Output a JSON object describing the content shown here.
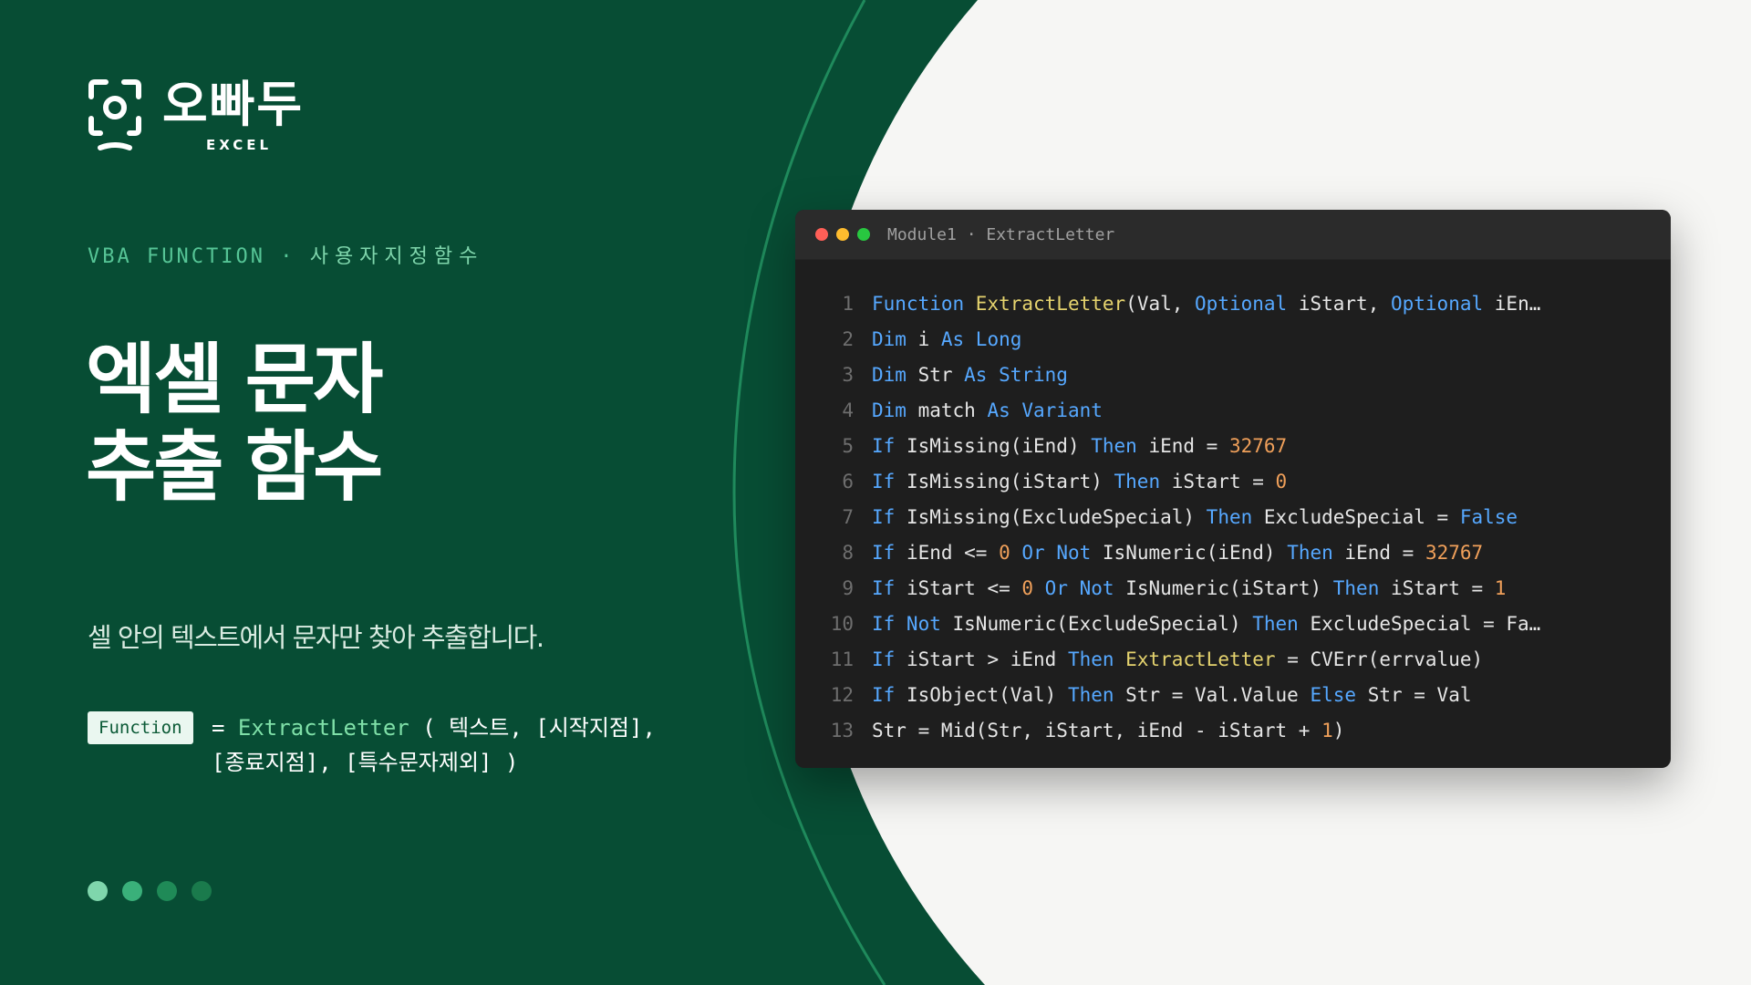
{
  "colors": {
    "dark_green": "#074d34",
    "accent_green": "#56c596",
    "light_bg": "#f6f6f4",
    "editor_bg": "#1e1e1e"
  },
  "brand": {
    "name": "오빠두",
    "sub": "EXCEL",
    "icon": "camera-face-icon"
  },
  "subtitle": {
    "en": "VBA FUNCTION",
    "sep": "·",
    "ko": "사용자지정함수"
  },
  "title": {
    "line1": "엑셀 문자",
    "line2": "추출 함수"
  },
  "description": "셀 안의 텍스트에서 문자만 찾아 추출합니다.",
  "syntax": {
    "badge": "Function",
    "equals": "=",
    "fn": "ExtractLetter",
    "args_line1": "( 텍스트, [시작지점],",
    "args_line2": "[종료지점], [특수문자제외] )"
  },
  "pagination": {
    "total": 4
  },
  "editor": {
    "title": "Module1 · ExtractLetter",
    "lines": [
      {
        "n": "1",
        "t": [
          [
            "kw",
            "Function "
          ],
          [
            "fnn",
            "ExtractLetter"
          ],
          [
            "",
            "(Val, "
          ],
          [
            "kw",
            "Optional"
          ],
          [
            "",
            " iStart, "
          ],
          [
            "kw",
            "Optional"
          ],
          [
            "",
            " iEn…"
          ]
        ]
      },
      {
        "n": "2",
        "t": [
          [
            "kw",
            "Dim "
          ],
          [
            "",
            "i "
          ],
          [
            "kw",
            "As Long"
          ]
        ]
      },
      {
        "n": "3",
        "t": [
          [
            "kw",
            "Dim "
          ],
          [
            "",
            "Str "
          ],
          [
            "kw",
            "As String"
          ]
        ]
      },
      {
        "n": "4",
        "t": [
          [
            "kw",
            "Dim "
          ],
          [
            "",
            "match "
          ],
          [
            "kw",
            "As Variant"
          ]
        ]
      },
      {
        "n": "5",
        "t": [
          [
            "kw",
            "If "
          ],
          [
            "",
            "IsMissing(iEnd) "
          ],
          [
            "kw",
            "Then "
          ],
          [
            "",
            "iEnd = "
          ],
          [
            "num",
            "32767"
          ]
        ]
      },
      {
        "n": "6",
        "t": [
          [
            "kw",
            "If "
          ],
          [
            "",
            "IsMissing(iStart) "
          ],
          [
            "kw",
            "Then "
          ],
          [
            "",
            "iStart = "
          ],
          [
            "num",
            "0"
          ]
        ]
      },
      {
        "n": "7",
        "t": [
          [
            "kw",
            "If "
          ],
          [
            "",
            "IsMissing(ExcludeSpecial) "
          ],
          [
            "kw",
            "Then "
          ],
          [
            "",
            "ExcludeSpecial = "
          ],
          [
            "bool",
            "False"
          ]
        ]
      },
      {
        "n": "8",
        "t": [
          [
            "kw",
            "If "
          ],
          [
            "",
            "iEnd <= "
          ],
          [
            "num",
            "0 "
          ],
          [
            "kw",
            "Or Not "
          ],
          [
            "",
            "IsNumeric(iEnd) "
          ],
          [
            "kw",
            "Then "
          ],
          [
            "",
            "iEnd = "
          ],
          [
            "num",
            "32767"
          ]
        ]
      },
      {
        "n": "9",
        "t": [
          [
            "kw",
            "If "
          ],
          [
            "",
            "iStart <= "
          ],
          [
            "num",
            "0 "
          ],
          [
            "kw",
            "Or Not "
          ],
          [
            "",
            "IsNumeric(iStart) "
          ],
          [
            "kw",
            "Then "
          ],
          [
            "",
            "iStart = "
          ],
          [
            "num",
            "1"
          ]
        ]
      },
      {
        "n": "10",
        "t": [
          [
            "kw",
            "If Not "
          ],
          [
            "",
            "IsNumeric(ExcludeSpecial) "
          ],
          [
            "kw",
            "Then "
          ],
          [
            "",
            "ExcludeSpecial = Fa…"
          ]
        ]
      },
      {
        "n": "11",
        "t": [
          [
            "kw",
            "If "
          ],
          [
            "",
            "iStart > iEnd "
          ],
          [
            "kw",
            "Then "
          ],
          [
            "fnn",
            "ExtractLetter"
          ],
          [
            "",
            " = CVErr(errvalue)"
          ]
        ]
      },
      {
        "n": "12",
        "t": [
          [
            "kw",
            "If "
          ],
          [
            "",
            "IsObject(Val) "
          ],
          [
            "kw",
            "Then "
          ],
          [
            "",
            "Str = Val.Value "
          ],
          [
            "kw",
            "Else "
          ],
          [
            "",
            "Str = Val"
          ]
        ]
      },
      {
        "n": "13",
        "t": [
          [
            "",
            "Str = Mid(Str, iStart, iEnd - iStart + "
          ],
          [
            "num",
            "1"
          ],
          [
            "",
            ")"
          ]
        ]
      }
    ]
  }
}
